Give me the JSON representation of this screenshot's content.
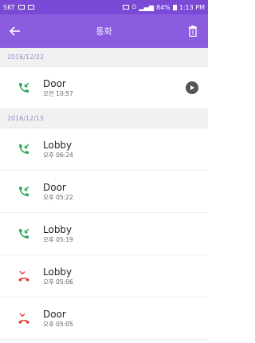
{
  "status": {
    "carrier": "SKT",
    "battery": "84%",
    "time": "1:13 PM"
  },
  "appbar": {
    "title": "통화"
  },
  "groups": [
    {
      "date": "2016/12/22",
      "items": [
        {
          "name": "Door",
          "time": "오전 10:57",
          "type": "received",
          "has_recording": true
        }
      ]
    },
    {
      "date": "2016/12/15",
      "items": [
        {
          "name": "Lobby",
          "time": "오후 06:24",
          "type": "received"
        },
        {
          "name": "Door",
          "time": "오후 05:22",
          "type": "received"
        },
        {
          "name": "Lobby",
          "time": "오후 05:19",
          "type": "received"
        },
        {
          "name": "Lobby",
          "time": "오후 05:06",
          "type": "missed"
        },
        {
          "name": "Door",
          "time": "오후 05:05",
          "type": "missed"
        }
      ]
    }
  ],
  "colors": {
    "appbar": "#8b5be0",
    "received": "#2fa85a",
    "missed": "#e0443a",
    "date_text": "#9b8fcb"
  },
  "icons": {
    "back": "arrow-left-icon",
    "delete": "trash-icon",
    "received": "incoming-call-icon",
    "missed": "missed-call-icon",
    "recording": "play-icon"
  }
}
